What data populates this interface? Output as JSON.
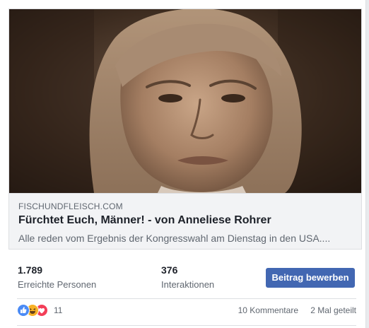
{
  "link_preview": {
    "domain": "FISCHUNDFLEISCH.COM",
    "headline": "Fürchtet Euch, Männer! - von Anneliese Rohrer",
    "description": "Alle reden vom Ergebnis der Kongresswahl am Dienstag in den USA...."
  },
  "insights": {
    "reach_value": "1.789",
    "reach_label": "Erreichte Personen",
    "interactions_value": "376",
    "interactions_label": "Interaktionen",
    "boost_label": "Beitrag bewerben"
  },
  "footer": {
    "reaction_icons": [
      "like-icon",
      "haha-icon",
      "love-icon"
    ],
    "reaction_count": "11",
    "comments_label": "10 Kommentare",
    "shares_label": "2 Mal geteilt"
  },
  "colors": {
    "accent": "#4267b2",
    "like": "#4b8bf5",
    "haha": "#f7b125",
    "love": "#f33e58",
    "text_primary": "#1d2129",
    "text_secondary": "#606770"
  }
}
